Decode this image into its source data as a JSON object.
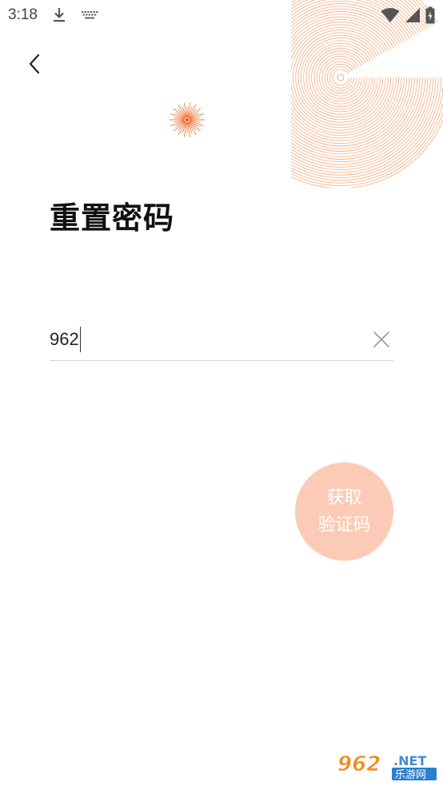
{
  "status_bar": {
    "time": "3:18",
    "icons": [
      "download-icon",
      "keyboard-icon",
      "wifi-icon",
      "signal-icon",
      "battery-icon"
    ]
  },
  "page": {
    "title": "重置密码",
    "back_icon": "chevron-left-icon"
  },
  "phone_field": {
    "value": "962",
    "clear_icon": "close-icon"
  },
  "code_button": {
    "line1": "获取",
    "line2": "验证码",
    "color": "#fccbb7"
  },
  "accent_color": "#f07b3f",
  "watermark": {
    "number": "962",
    "suffix": ".NET",
    "caption": "乐游网"
  }
}
